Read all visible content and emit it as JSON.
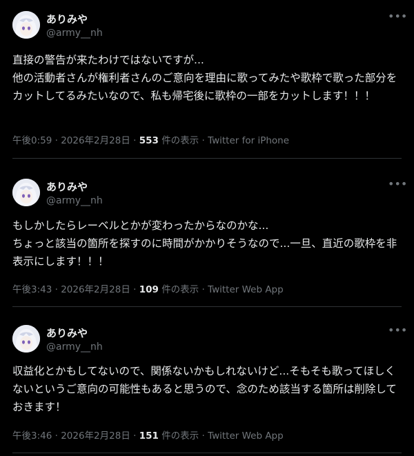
{
  "tweets": [
    {
      "name": "ありみや",
      "handle": "@army__nh",
      "body": "直接の警告が来たわけではないですが...\n他の活動者さんが権利者さんのご意向を理由に歌ってみたや歌枠で歌った部分をカットしてるみたいなので、私も帰宅後に歌枠の一部をカットします！！！",
      "time": "午後0:59",
      "date": "2026年2月28日",
      "views": "553",
      "views_suffix": "件の表示",
      "source": "Twitter for iPhone"
    },
    {
      "name": "ありみや",
      "handle": "@army__nh",
      "body": "もしかしたらレーベルとかが変わったからなのかな...\nちょっと該当の箇所を探すのに時間がかかりそうなので...一旦、直近の歌枠を非表示にします！！！",
      "time": "午後3:43",
      "date": "2026年2月28日",
      "views": "109",
      "views_suffix": "件の表示",
      "source": "Twitter Web App"
    },
    {
      "name": "ありみや",
      "handle": "@army__nh",
      "body": "収益化とかもしてないので、関係ないかもしれないけど...そもそも歌ってほしくないというご意向の可能性もあると思うので、念のため該当する箇所は削除しておきます！",
      "time": "午後3:46",
      "date": "2026年2月28日",
      "views": "151",
      "views_suffix": "件の表示",
      "source": "Twitter Web App"
    }
  ],
  "more_icon": "more-horizontal-icon",
  "separator": " · ",
  "colors": {
    "background": "#000000",
    "text": "#e7e9ea",
    "muted": "#71767b",
    "divider": "#2f3336"
  }
}
